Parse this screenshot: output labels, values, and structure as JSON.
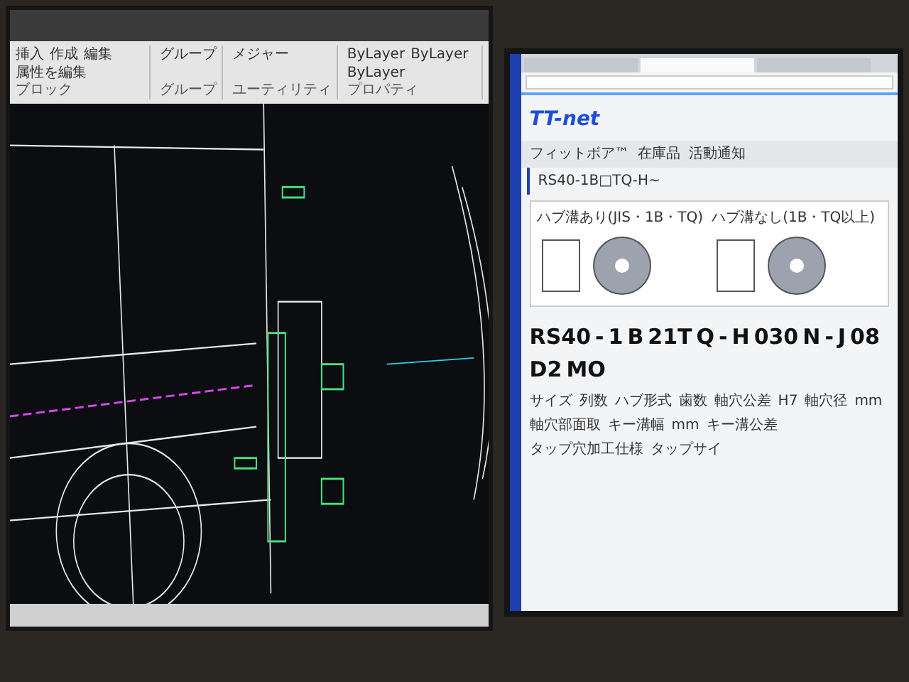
{
  "cad": {
    "ribbon_groups": [
      {
        "label": "ブロック",
        "tools": [
          "挿入",
          "作成",
          "編集",
          "属性を編集"
        ]
      },
      {
        "label": "グループ",
        "tools": [
          "グループ"
        ]
      },
      {
        "label": "ユーティリティ",
        "tools": [
          "メジャー"
        ]
      },
      {
        "label": "プロパティ",
        "tools": [
          "ByLayer",
          "ByLayer",
          "ByLayer"
        ]
      }
    ]
  },
  "browser": {
    "tabs": [
      {
        "selected": false
      },
      {
        "selected": true
      },
      {
        "selected": false
      }
    ],
    "logo": "TT-net",
    "nav": [
      "フィットボア™",
      "在庫品",
      "活動通知"
    ],
    "breadcrumb": "RS40-1B□TQ-H~",
    "figure_captions": [
      "ハブ溝あり(JIS・1B・TQ)",
      "ハブ溝なし(1B・TQ以上)"
    ],
    "part_number": [
      "RS40",
      "-",
      "1",
      "B",
      "21T",
      "Q",
      "-",
      "H",
      "030",
      "N",
      "-",
      "J",
      "08",
      "D2",
      "MO"
    ],
    "legend": [
      "サイズ",
      "列数",
      "ハブ形式",
      "歯数",
      "軸穴公差",
      "H7",
      "軸穴径",
      "mm",
      "軸穴部面取",
      "キー溝幅",
      "mm",
      "キー溝公差",
      "タップ穴加工仕様",
      "タップサイ"
    ]
  }
}
